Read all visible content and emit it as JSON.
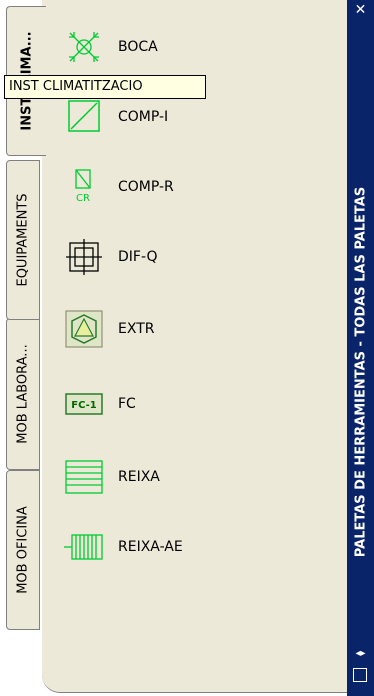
{
  "palette": {
    "title": "PALETAS DE HERRAMIENTAS - TODAS LAS PALETAS",
    "close_icon": "close-icon",
    "tabs": [
      {
        "label": "INST CLIMA..."
      },
      {
        "label": "EQUIPAMENTS"
      },
      {
        "label": "MOB LABORA..."
      },
      {
        "label": "MOB OFICINA"
      }
    ],
    "tooltip": "INST CLIMATITZACIO",
    "tools": [
      {
        "label": "BOCA",
        "icon": "boca-icon"
      },
      {
        "label": "COMP-I",
        "icon": "comp-i-icon"
      },
      {
        "label": "COMP-R",
        "icon": "comp-r-icon",
        "icon_text": "CR"
      },
      {
        "label": "DIF-Q",
        "icon": "dif-q-icon"
      },
      {
        "label": "EXTR",
        "icon": "extr-icon"
      },
      {
        "label": "FC",
        "icon": "fc-icon",
        "icon_text": "FC-1"
      },
      {
        "label": "REIXA",
        "icon": "reixa-icon"
      },
      {
        "label": "REIXA-AE",
        "icon": "reixa-ae-icon"
      }
    ],
    "colors": {
      "titlebar": "#0a246a",
      "panel": "#ece9d8",
      "icon_green": "#00cc33"
    }
  }
}
